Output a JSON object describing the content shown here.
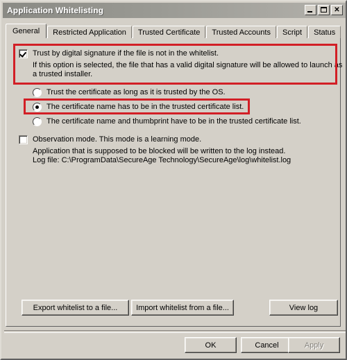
{
  "window": {
    "title": "Application Whitelisting",
    "controls": {
      "minimize": "minimize-icon",
      "maximize": "maximize-icon",
      "close": "✕"
    }
  },
  "tabs": [
    {
      "label": "General",
      "active": true
    },
    {
      "label": "Restricted Application",
      "active": false
    },
    {
      "label": "Trusted Certificate",
      "active": false
    },
    {
      "label": "Trusted Accounts",
      "active": false
    },
    {
      "label": "Script",
      "active": false
    },
    {
      "label": "Status",
      "active": false
    }
  ],
  "general": {
    "trust_signature": {
      "label": "Trust by digital signature if the file is not in the whitelist.",
      "checked": true,
      "description_line1": "If this option is selected, the file that has a valid digital signature will be allowed to launch as",
      "description_line2": "a trusted installer."
    },
    "certificate_options": [
      {
        "label": "Trust the certificate as long as it is trusted by the OS.",
        "selected": false
      },
      {
        "label": "The certificate name has to be in the trusted certificate list.",
        "selected": true
      },
      {
        "label": "The certificate name and thumbprint have to be in the trusted certificate list.",
        "selected": false
      }
    ],
    "observation_mode": {
      "label": "Observation mode. This mode is a learning mode.",
      "checked": false,
      "description": "Application that is supposed to be blocked will be written to the log instead.",
      "log_file_line": "Log file: C:\\ProgramData\\SecureAge Technology\\SecureAge\\log\\whitelist.log"
    },
    "buttons": {
      "export": "Export whitelist to a file...",
      "import": "Import whitelist from a file...",
      "view_log": "View log"
    }
  },
  "dialog_buttons": {
    "ok": "OK",
    "cancel": "Cancel",
    "apply": "Apply",
    "apply_enabled": false
  },
  "annotations": {
    "highlight_color": "#d21f26",
    "boxes": [
      {
        "name": "trust-signature-highlight"
      },
      {
        "name": "certificate-name-option-highlight"
      }
    ]
  }
}
